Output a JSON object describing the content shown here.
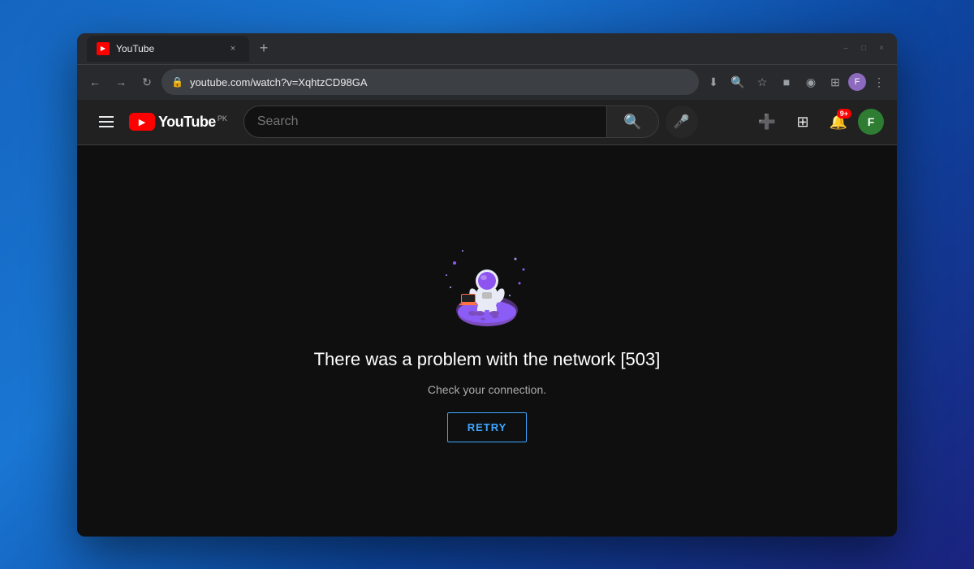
{
  "browser": {
    "tab": {
      "favicon_label": "YouTube favicon",
      "title": "YouTube",
      "close_label": "×"
    },
    "new_tab_label": "+",
    "window_controls": {
      "minimize": "–",
      "maximize": "□",
      "close": "×"
    },
    "nav": {
      "back_label": "←",
      "forward_label": "→",
      "reload_label": "↻"
    },
    "address": {
      "url": "youtube.com/watch?v=XqhtzCD98GA",
      "lock_icon": "🔒"
    },
    "actions": {
      "download_icon": "⬇",
      "zoom_icon": "🔍",
      "bookmark_icon": "☆",
      "extension1_icon": "■",
      "extension2_icon": "◉",
      "puzzle_icon": "⊞",
      "menu_icon": "⋮"
    },
    "profile_label": "F"
  },
  "youtube": {
    "logo_text": "YouTube",
    "logo_suffix": "PK",
    "search_placeholder": "Search",
    "header_actions": {
      "create_icon": "➕",
      "apps_icon": "⊞",
      "notifications_icon": "🔔",
      "notification_count": "9+",
      "avatar_label": "F"
    },
    "error": {
      "illustration_label": "astronaut on planet",
      "title": "There was a problem with the network [503]",
      "subtitle": "Check your connection.",
      "retry_label": "RETRY"
    }
  }
}
